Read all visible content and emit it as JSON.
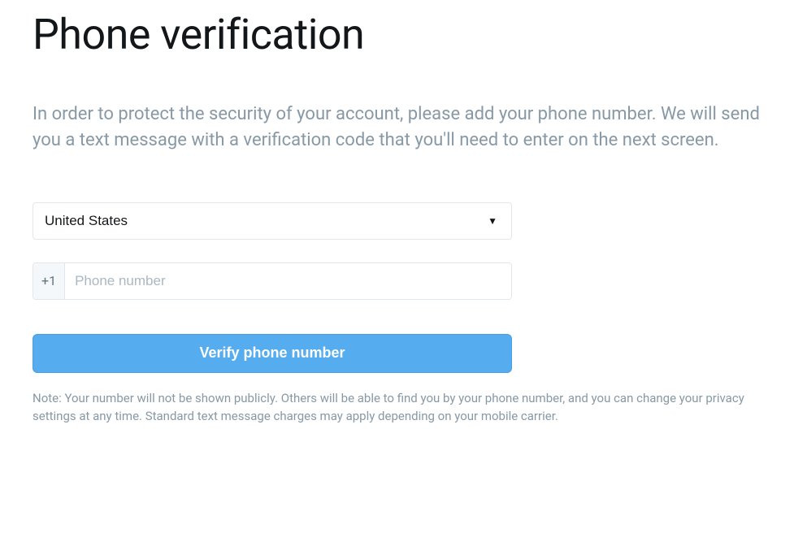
{
  "title": "Phone verification",
  "description": "In order to protect the security of your account, please add your phone number. We will send you a text message with a verification code that you'll need to enter on the next screen.",
  "form": {
    "country_selected": "United States",
    "country_code": "+1",
    "phone_placeholder": "Phone number",
    "verify_button": "Verify phone number"
  },
  "note": "Note: Your number will not be shown publicly. Others will be able to find you by your phone number, and you can change your privacy settings at any time. Standard text message charges may apply depending on your mobile carrier."
}
